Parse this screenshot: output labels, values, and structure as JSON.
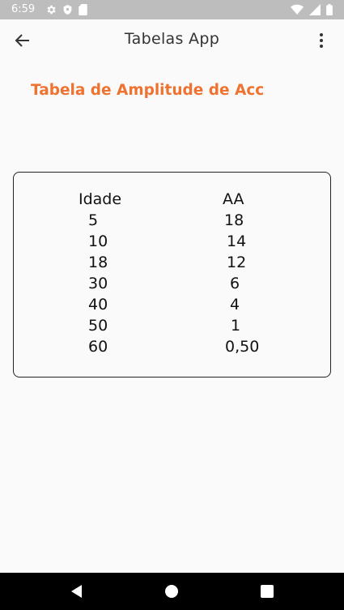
{
  "status_bar": {
    "time": "6:59",
    "icons": [
      "gear-icon",
      "shield-icon",
      "sd-card-icon",
      "wifi-icon",
      "signal-icon",
      "battery-icon"
    ]
  },
  "app_bar": {
    "title": "Tabelas App",
    "back_icon": "arrow-back-icon",
    "menu_icon": "more-vert-icon"
  },
  "page": {
    "heading": "Tabela de Amplitude de Acc",
    "heading_color": "#ee7330"
  },
  "table": {
    "headers": [
      "Idade",
      "AA"
    ],
    "rows": [
      [
        "5",
        "18"
      ],
      [
        "10",
        "14"
      ],
      [
        "18",
        "12"
      ],
      [
        "30",
        "6"
      ],
      [
        "40",
        "4"
      ],
      [
        "50",
        "1"
      ],
      [
        "60",
        "0,50"
      ]
    ]
  },
  "nav_bar": {
    "icons": [
      "back-triangle-icon",
      "home-circle-icon",
      "recents-square-icon"
    ]
  }
}
